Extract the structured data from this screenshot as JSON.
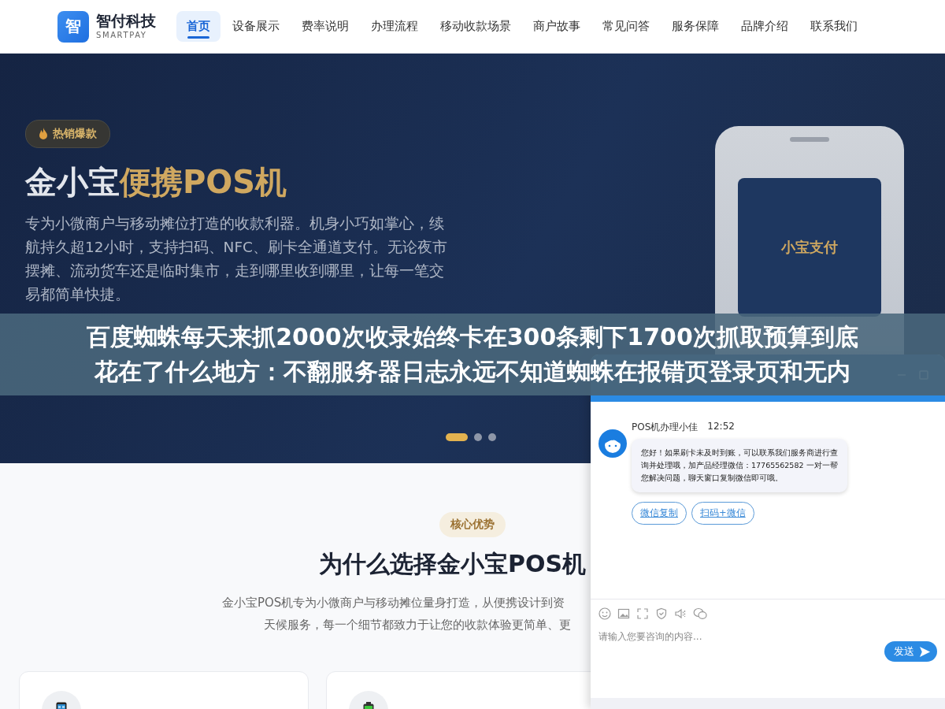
{
  "header": {
    "logo_mark": "智",
    "brand": "智付科技",
    "brand_sub": "SMARTPAY",
    "nav": [
      {
        "label": "首页",
        "selected": true
      },
      {
        "label": "设备展示",
        "selected": false
      },
      {
        "label": "费率说明",
        "selected": false
      },
      {
        "label": "办理流程",
        "selected": false
      },
      {
        "label": "移动收款场景",
        "selected": false
      },
      {
        "label": "商户故事",
        "selected": false
      },
      {
        "label": "常见问答",
        "selected": false
      },
      {
        "label": "服务保障",
        "selected": false
      },
      {
        "label": "品牌介绍",
        "selected": false
      },
      {
        "label": "联系我们",
        "selected": false
      }
    ]
  },
  "hero": {
    "badge": "热销爆款",
    "title_plain": "金小宝",
    "title_accent": "便携POS机",
    "description": "专为小微商户与移动摊位打造的收款利器。机身小巧如掌心，续航持久超12小时，支持扫码、NFC、刷卡全通道支付。无论夜市摆摊、流动货车还是临时集市，走到哪里收到哪里，让每一笔交易都简单快捷。",
    "device_screen_text": "小宝支付",
    "slides": [
      {
        "selected": true
      },
      {
        "selected": false
      },
      {
        "selected": false
      }
    ]
  },
  "advantages": {
    "badge": "核心优势",
    "title": "为什么选择金小宝POS机",
    "subtitle_lines": [
      "金小宝POS机专为小微商户与移动摊位量身打造，从便携设计到资",
      "天候服务，每一个细节都致力于让您的收款体验更简单、更"
    ],
    "cards": [
      {
        "kind": "phone"
      },
      {
        "kind": "battery"
      }
    ]
  },
  "overlay_caption": [
    "百度蜘蛛每天来抓2000次收录始终卡在300条剩下1700次抓取预算到底",
    "花在了什么地方：不翻服务器日志永远不知道蜘蛛在报错页登录页和无内"
  ],
  "chat": {
    "agent": "POS机办理小佳",
    "time": "12:52",
    "message": "您好！如果刷卡未及时到账，可以联系我们服务商进行查询并处理哦，加产品经理微信：17765562582 一对一帮您解决问题，聊天窗口复制微信即可哦。",
    "actions": [
      "微信复制",
      "扫码+微信"
    ],
    "input": {
      "placeholder": "请输入您要咨询的内容..."
    },
    "send": "发送"
  }
}
